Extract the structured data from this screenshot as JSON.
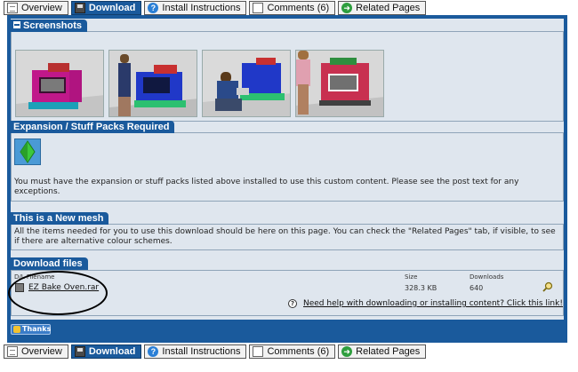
{
  "tabs": [
    {
      "label": "Overview",
      "icon": "document-icon",
      "active": false
    },
    {
      "label": "Download",
      "icon": "disk-icon",
      "active": true
    },
    {
      "label": "Install Instructions",
      "icon": "help-icon",
      "active": false
    },
    {
      "label": "Comments (6)",
      "icon": "comment-icon",
      "active": false
    },
    {
      "label": "Related Pages",
      "icon": "arrow-icon",
      "active": false
    }
  ],
  "screenshots": {
    "title": "Screenshots"
  },
  "expansion": {
    "title": "Expansion / Stuff Packs Required",
    "notice": "You must have the expansion or stuff packs listed above installed to use this custom content. Please see the post text for any exceptions."
  },
  "mesh": {
    "title": "This is a New mesh",
    "text": "All the items needed for you to use this download should be here on this page. You can check the \"Related Pages\" tab, if visible, to see if there are alternative colour schemes."
  },
  "downloads": {
    "title": "Download files",
    "columns": {
      "filename": "D/L Filename",
      "size": "Size",
      "downloads": "Downloads"
    },
    "files": [
      {
        "name": "EZ Bake Oven.rar",
        "size": "328.3 KB",
        "downloads": "640"
      }
    ],
    "help_link": "Need help with downloading or installing content? Click this link!"
  },
  "thanks_label": "Thanks",
  "colors": {
    "accent": "#1a5a9c",
    "panel_bg": "#dfe6ee"
  }
}
